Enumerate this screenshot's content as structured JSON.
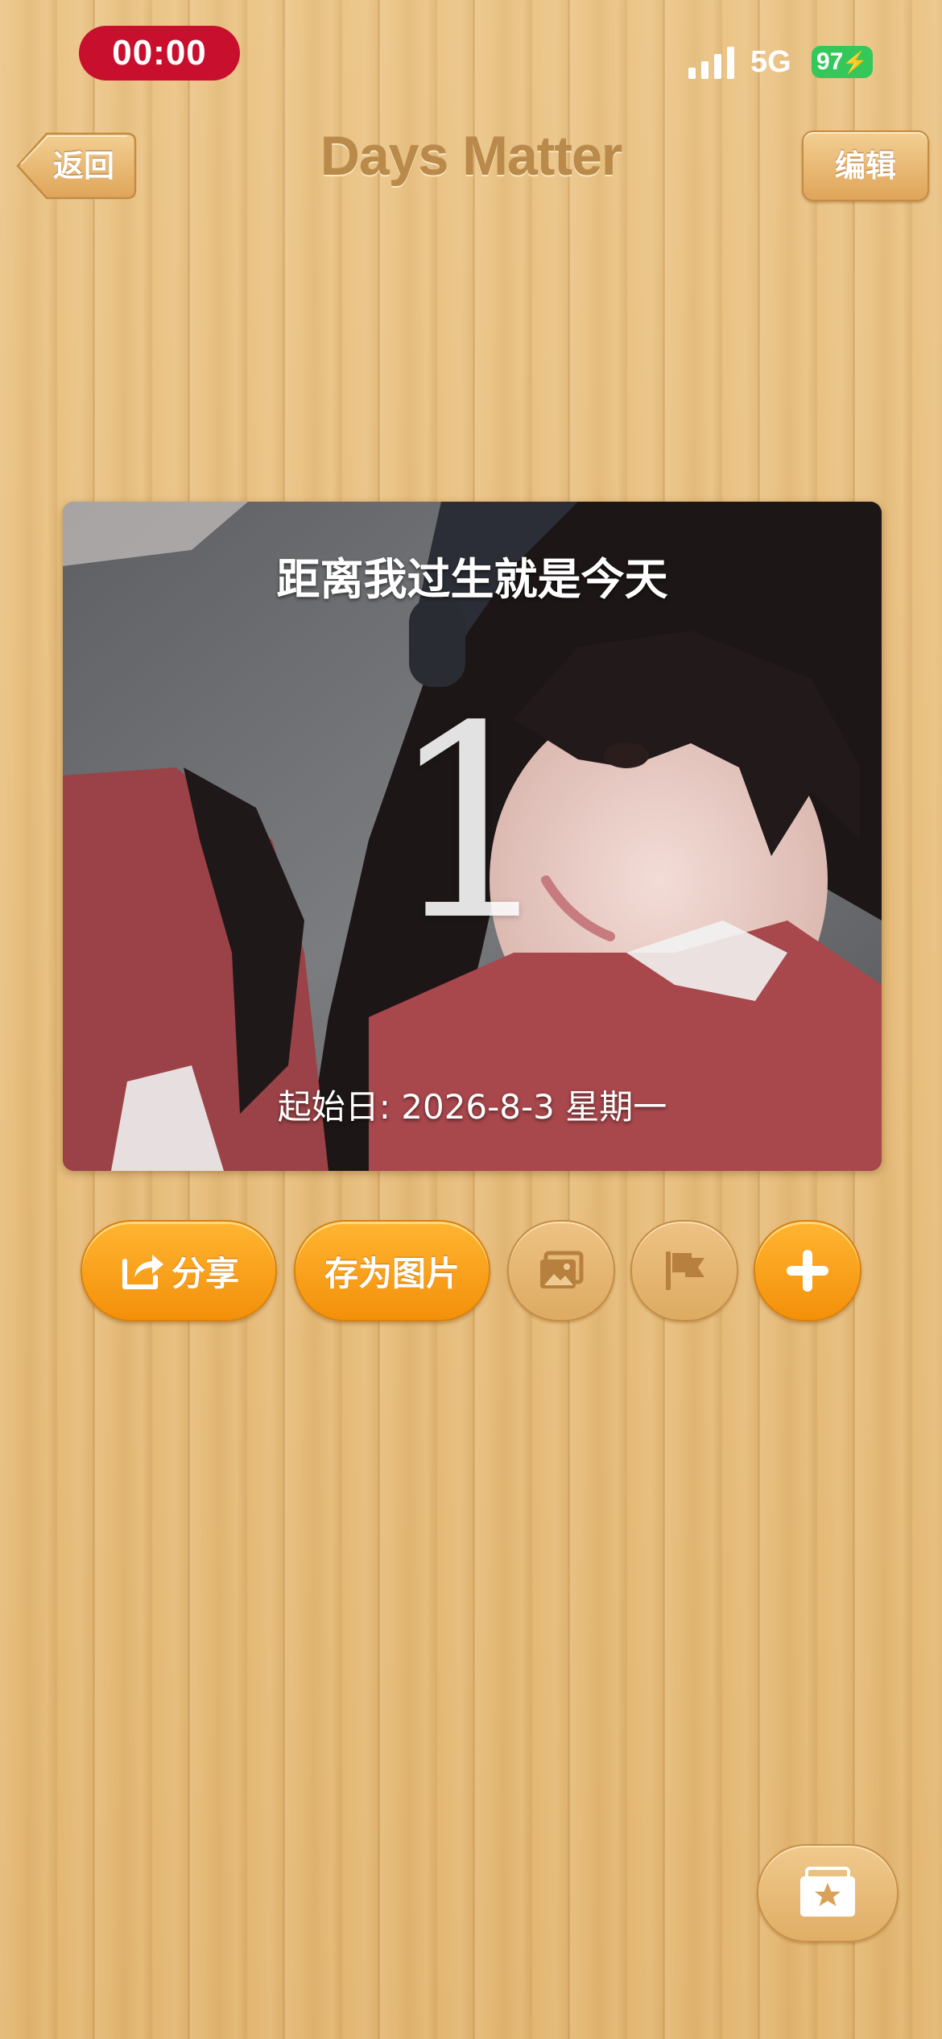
{
  "status_bar": {
    "timer": "00:00",
    "network": "5G",
    "battery": "97"
  },
  "nav": {
    "back_label": "返回",
    "title": "Days Matter",
    "edit_label": "编辑"
  },
  "card": {
    "title": "距离我过生就是今天",
    "count": "1",
    "start_date": "起始日: 2026-8-3 星期一"
  },
  "actions": {
    "share_label": "分享",
    "save_image_label": "存为图片"
  },
  "icons": {
    "signal": "signal-bars-icon",
    "bolt": "charging-bolt-icon",
    "share": "share-arrow-icon",
    "background_photo": "photo-icon",
    "flag": "flag-icon",
    "add": "plus-icon",
    "card_stack": "star-card-stack-icon"
  },
  "colors": {
    "timer_pill": "#c8102e",
    "battery": "#34c759",
    "accent_orange": "#f3900a",
    "wood": "#e7bd7b"
  }
}
